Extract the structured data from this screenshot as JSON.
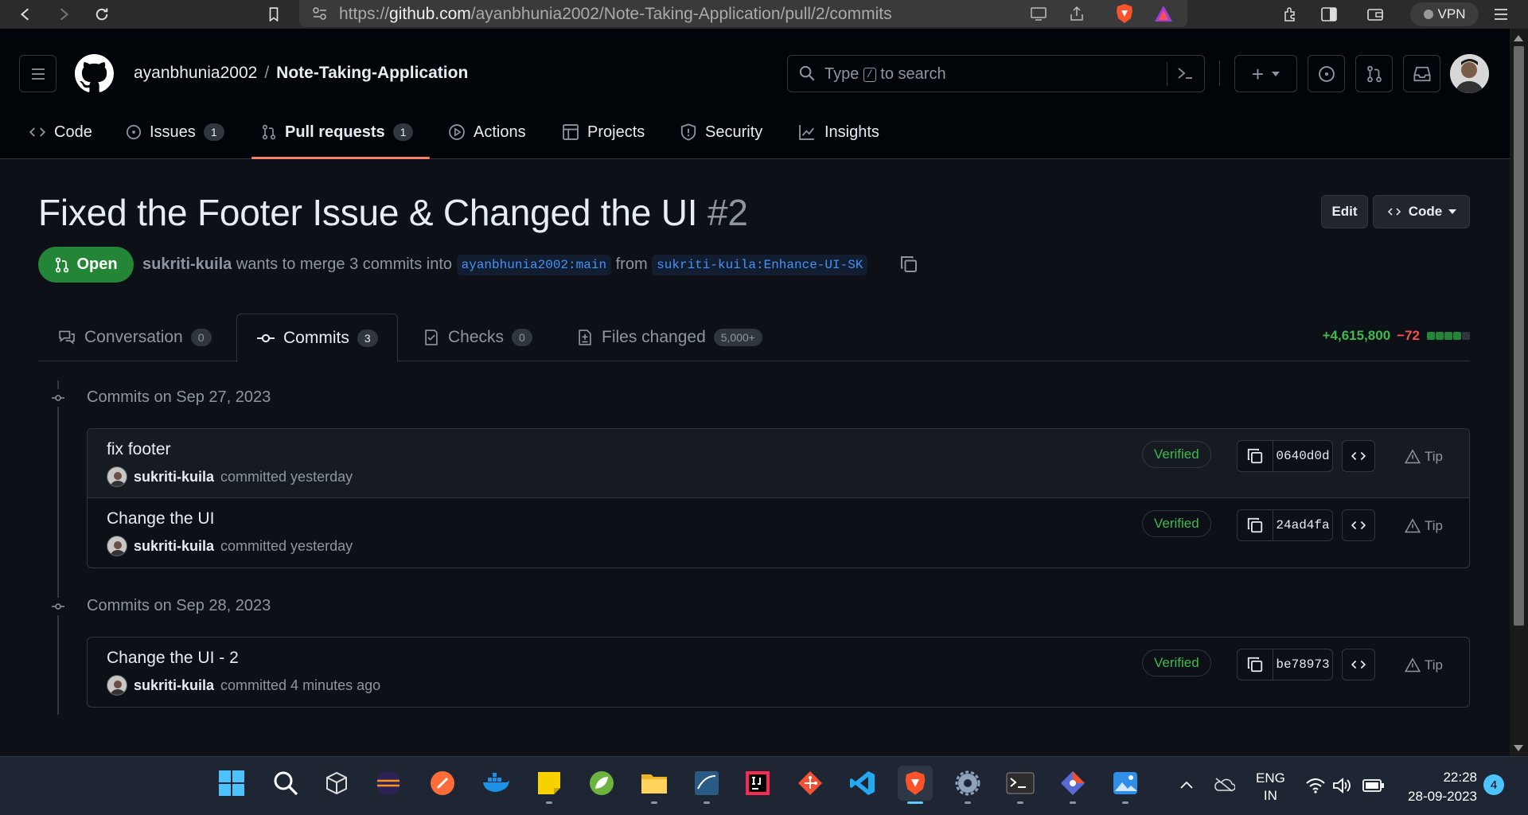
{
  "browser": {
    "url_prefix": "https://",
    "url_host": "github.com",
    "url_path": "/ayanbhunia2002/Note-Taking-Application/pull/2/commits",
    "vpn_label": "VPN"
  },
  "header": {
    "owner": "ayanbhunia2002",
    "separator": "/",
    "repo": "Note-Taking-Application",
    "search_placeholder_pre": "Type",
    "search_key": "/",
    "search_placeholder_post": "to search",
    "plus_label": "+"
  },
  "repo_tabs": [
    {
      "label": "Code",
      "icon": "code-icon"
    },
    {
      "label": "Issues",
      "count": "1",
      "icon": "issue-icon"
    },
    {
      "label": "Pull requests",
      "count": "1",
      "icon": "pull-request-icon"
    },
    {
      "label": "Actions",
      "icon": "play-icon"
    },
    {
      "label": "Projects",
      "icon": "table-icon"
    },
    {
      "label": "Security",
      "icon": "shield-icon"
    },
    {
      "label": "Insights",
      "icon": "graph-icon"
    }
  ],
  "pr": {
    "title": "Fixed the Footer Issue & Changed the UI",
    "number": "#2",
    "edit_label": "Edit",
    "code_label": "Code",
    "state": "Open",
    "author": "sukriti-kuila",
    "merge_text_1": "wants to merge 3 commits into",
    "base_branch": "ayanbhunia2002:main",
    "merge_text_2": "from",
    "head_branch": "sukriti-kuila:Enhance-UI-SK"
  },
  "pr_tabs": [
    {
      "label": "Conversation",
      "count": "0"
    },
    {
      "label": "Commits",
      "count": "3"
    },
    {
      "label": "Checks",
      "count": "0"
    },
    {
      "label": "Files changed",
      "count": "5,000+"
    }
  ],
  "diffstat": {
    "additions": "+4,615,800",
    "deletions": "−72"
  },
  "commit_groups": [
    {
      "header": "Commits on Sep 27, 2023",
      "commits": [
        {
          "title": "fix footer",
          "author": "sukriti-kuila",
          "time": "committed yesterday",
          "verified": "Verified",
          "sha": "0640d0d",
          "tip": "Tip"
        },
        {
          "title": "Change the UI",
          "author": "sukriti-kuila",
          "time": "committed yesterday",
          "verified": "Verified",
          "sha": "24ad4fa",
          "tip": "Tip"
        }
      ]
    },
    {
      "header": "Commits on Sep 28, 2023",
      "commits": [
        {
          "title": "Change the UI - 2",
          "author": "sukriti-kuila",
          "time": "committed 4 minutes ago",
          "verified": "Verified",
          "sha": "be78973",
          "tip": "Tip"
        }
      ]
    }
  ],
  "taskbar": {
    "lang_1": "ENG",
    "lang_2": "IN",
    "time": "22:28",
    "date": "28-09-2023",
    "notifications": "4"
  },
  "colors": {
    "accent_green": "#238636",
    "verified_green": "#3fb950",
    "deletion_red": "#f85149",
    "tab_underline": "#f78166",
    "branch_blue": "#4493f8"
  }
}
